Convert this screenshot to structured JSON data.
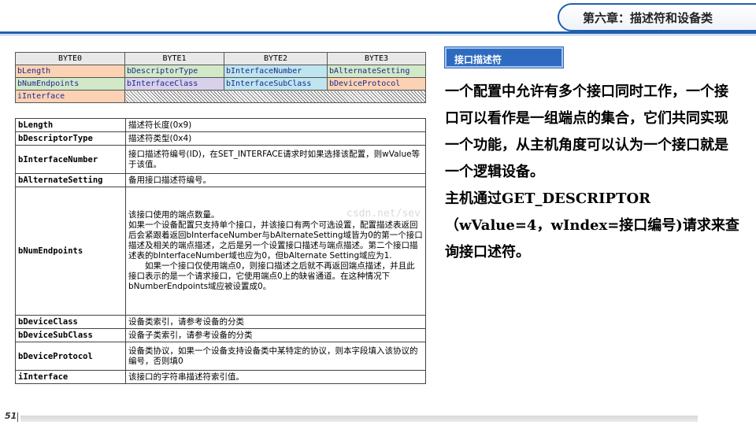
{
  "header": {
    "chapter_title": "第六章：描述符和设备类"
  },
  "byte_table": {
    "headers": [
      "BYTE0",
      "BYTE1",
      "BYTE2",
      "BYTE3"
    ],
    "rows": [
      [
        "bLength",
        "bDescriptorType",
        "bInterfaceNumber",
        "bAlternateSetting"
      ],
      [
        "bNumEndpoints",
        "bInterfaceClass",
        "bInterfaceSubClass",
        "bDeviceProtocol"
      ],
      [
        "iInterface"
      ]
    ]
  },
  "fields": [
    {
      "name": "bLength",
      "desc": "描述符长度(0x9)"
    },
    {
      "name": "bDescriptorType",
      "desc": "描述符类型(0x4)"
    },
    {
      "name": "bInterfaceNumber",
      "desc": "接口描述符编号(ID)，在SET_INTERFACE请求时如果选择该配置，则wValue等于该值。"
    },
    {
      "name": "bAlternateSetting",
      "desc": "备用接口描述符编号。"
    },
    {
      "name": "bNumEndpoints",
      "desc_lines": [
        "该接口使用的端点数量。",
        "如果一个设备配置只支持单个接口，并该接口有两个可选设置，配置描述表返回后会紧跟着返回bInterfaceNumber与bAlternateSetting域皆为0的第一个接口描述及相关的端点描述，之后是另一个设置接口描述与端点描述。第二个接口描述表的bInterfaceNumber域也应为0，但bAlternate Setting域应为1.",
        "如果一个接口仅使用端点0，则接口描述之后就不再返回端点描述，并且此接口表示的是一个请求接口，它使用端点0上的缺省通道。在这种情况下bNumberEndpoints域应被设置成0。"
      ]
    },
    {
      "name": "bDeviceClass",
      "desc": "设备类索引，请参考设备的分类"
    },
    {
      "name": "bDeviceSubClass",
      "desc": "设备子类索引，请参考设备的分类"
    },
    {
      "name": "bDeviceProtocol",
      "desc": "设备类协议，如果一个设备支持设备类中某特定的协议，则本字段填入该协议的编号，否则填0"
    },
    {
      "name": "iInterface",
      "desc": "该接口的字符串描述符索引值。"
    }
  ],
  "annotation": {
    "label": "接口描述符"
  },
  "body": {
    "paragraphs": [
      "一个配置中允许有多个接口同时工作，一个接口可以看作是一组端点的集合，它们共同实现一个功能，从主机角度可以认为一个接口就是一个逻辑设备。",
      "主机通过GET_DESCRIPTOR（wValue=4，wIndex=接口编号)请求来查询接口述符。"
    ]
  },
  "watermark": "csdn.net/sev",
  "footer": {
    "page_number": "51"
  }
}
